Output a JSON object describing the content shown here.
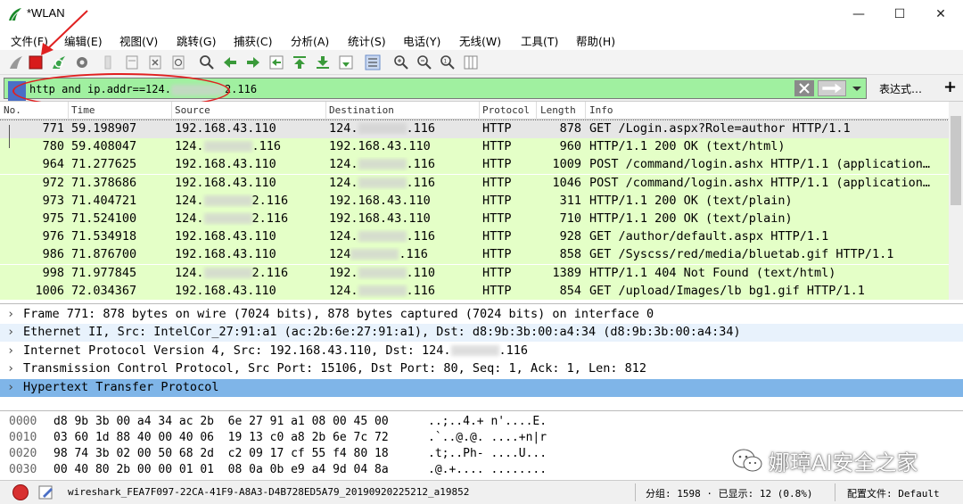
{
  "window": {
    "title": "*WLAN",
    "minimize": "—",
    "maximize": "☐",
    "close": "✕"
  },
  "menu": [
    "文件(F)",
    "编辑(E)",
    "视图(V)",
    "跳转(G)",
    "捕获(C)",
    "分析(A)",
    "统计(S)",
    "电话(Y)",
    "无线(W)",
    "工具(T)",
    "帮助(H)"
  ],
  "toolbar_icons": [
    "shark-fin-start-icon",
    "stop-capture-icon",
    "restart-capture-icon",
    "capture-options-icon",
    "open-file-icon",
    "save-file-icon",
    "close-file-icon",
    "reload-file-icon",
    "find-packet-icon",
    "go-back-icon",
    "go-forward-icon",
    "go-to-packet-icon",
    "go-first-icon",
    "go-last-icon",
    "auto-scroll-icon",
    "colorize-icon",
    "zoom-in-icon",
    "zoom-out-icon",
    "zoom-normal-icon",
    "resize-columns-icon"
  ],
  "filter": {
    "value_prefix": "http and ip.addr==124.",
    "value_suffix": "2.116",
    "expression_button": "表达式…",
    "add_button": "+"
  },
  "packet_list": {
    "columns": [
      "No.",
      "Time",
      "Source",
      "Destination",
      "Protocol",
      "Length",
      "Info"
    ],
    "rows": [
      {
        "no": "771",
        "time": "59.198907",
        "src": "192.168.43.110",
        "dst": "124.",
        "dst_suffix": ".116",
        "proto": "HTTP",
        "len": "878",
        "info": "GET /Login.aspx?Role=author HTTP/1.1",
        "selected": true
      },
      {
        "no": "780",
        "time": "59.408047",
        "src": "124.",
        "src_suffix": ".116",
        "dst": "192.168.43.110",
        "proto": "HTTP",
        "len": "960",
        "info": "HTTP/1.1 200 OK  (text/html)"
      },
      {
        "no": "964",
        "time": "71.277625",
        "src": "192.168.43.110",
        "dst": "124.",
        "dst_suffix": ".116",
        "proto": "HTTP",
        "len": "1009",
        "info": "POST /command/login.ashx HTTP/1.1  (application…"
      },
      {
        "no": "972",
        "time": "71.378686",
        "src": "192.168.43.110",
        "dst": "124.",
        "dst_suffix": ".116",
        "proto": "HTTP",
        "len": "1046",
        "info": "POST /command/login.ashx HTTP/1.1  (application…"
      },
      {
        "no": "973",
        "time": "71.404721",
        "src": "124.",
        "src_suffix": "2.116",
        "dst": "192.168.43.110",
        "proto": "HTTP",
        "len": "311",
        "info": "HTTP/1.1 200 OK  (text/plain)"
      },
      {
        "no": "975",
        "time": "71.524100",
        "src": "124.",
        "src_suffix": "2.116",
        "dst": "192.168.43.110",
        "proto": "HTTP",
        "len": "710",
        "info": "HTTP/1.1 200 OK  (text/plain)"
      },
      {
        "no": "976",
        "time": "71.534918",
        "src": "192.168.43.110",
        "dst": "124.",
        "dst_suffix": ".116",
        "proto": "HTTP",
        "len": "928",
        "info": "GET /author/default.aspx HTTP/1.1"
      },
      {
        "no": "986",
        "time": "71.876700",
        "src": "192.168.43.110",
        "dst": "124",
        "dst_suffix": ".116",
        "proto": "HTTP",
        "len": "858",
        "info": "GET /Syscss/red/media/bluetab.gif HTTP/1.1"
      },
      {
        "no": "998",
        "time": "71.977845",
        "src": "124.",
        "src_suffix": "2.116",
        "dst": "192.",
        "dst_suffix": ".110",
        "proto": "HTTP",
        "len": "1389",
        "info": "HTTP/1.1 404 Not Found  (text/html)"
      },
      {
        "no": "1006",
        "time": "72.034367",
        "src": "192.168.43.110",
        "dst": "124.",
        "dst_suffix": ".116",
        "proto": "HTTP",
        "len": "854",
        "info": "GET /upload/Images/lb bg1.gif HTTP/1.1"
      }
    ]
  },
  "details": [
    {
      "text": "Frame 771: 878 bytes on wire (7024 bits), 878 bytes captured (7024 bits) on interface 0",
      "style": "normal"
    },
    {
      "text": "Ethernet II, Src: IntelCor_27:91:a1 (ac:2b:6e:27:91:a1), Dst: d8:9b:3b:00:a4:34 (d8:9b:3b:00:a4:34)",
      "style": "light"
    },
    {
      "text": "Internet Protocol Version 4, Src: 192.168.43.110, Dst: 124.",
      "suffix": ".116",
      "style": "normal"
    },
    {
      "text": "Transmission Control Protocol, Src Port: 15106, Dst Port: 80, Seq: 1, Ack: 1, Len: 812",
      "style": "normal"
    },
    {
      "text": "Hypertext Transfer Protocol",
      "style": "selected"
    }
  ],
  "bytes": [
    {
      "offset": "0000",
      "hex": "d8 9b 3b 00 a4 34 ac 2b  6e 27 91 a1 08 00 45 00",
      "ascii": "..;..4.+ n'....E."
    },
    {
      "offset": "0010",
      "hex": "03 60 1d 88 40 00 40 06  19 13 c0 a8 2b 6e 7c 72",
      "ascii": ".`..@.@. ....+n|r"
    },
    {
      "offset": "0020",
      "hex": "98 74 3b 02 00 50 68 2d  c2 09 17 cf 55 f4 80 18",
      "ascii": ".t;..Ph- ....U..."
    },
    {
      "offset": "0030",
      "hex": "00 40 80 2b 00 00 01 01  08 0a 0b e9 a4 9d 04 8a",
      "ascii": ".@.+.... ........"
    }
  ],
  "watermark": "娜璋AI安全之家",
  "status": {
    "file": "wireshark_FEA7F097-22CA-41F9-A8A3-D4B728ED5A79_20190920225212_a19852",
    "stats": "分组: 1598 · 已显示: 12 (0.8%)",
    "profile": "配置文件: Default"
  },
  "colors": {
    "http_row": "#e4ffc7",
    "selected_row": "#e6e6e6",
    "filter_valid": "#a0f0a0",
    "details_highlight": "#7fb5e8",
    "details_light": "#e8f2fc",
    "annotation": "#e02020"
  }
}
